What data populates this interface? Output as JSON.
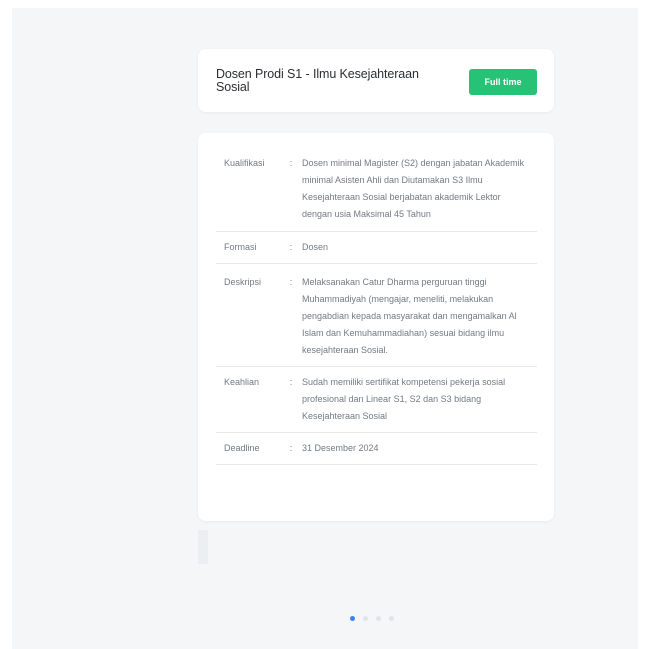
{
  "job": {
    "title": "Dosen Prodi S1 - Ilmu Kesejahteraan Sosial",
    "badge": "Full time"
  },
  "details": [
    {
      "label": "Kualifikasi",
      "value": "Dosen minimal Magister (S2) dengan jabatan Akademik minimal Asisten Ahli dan Diutamakan S3 Ilmu Kesejahteraan Sosial berjabatan akademik Lektor dengan usia Maksimal 45 Tahun"
    },
    {
      "label": "Formasi",
      "value": "Dosen"
    },
    {
      "label": "Deskripsi",
      "value": "Melaksanakan Catur Dharma perguruan tinggi Muhammadiyah (mengajar, meneliti, melakukan pengabdian kepada masyarakat dan mengamalkan Al Islam dan Kemuhammadiahan) sesuai bidang ilmu kesejahteraan Sosial."
    },
    {
      "label": "Keahlian",
      "value": "Sudah memiliki sertifikat kompetensi pekerja sosial profesional dan Linear S1, S2 dan S3 bidang Kesejahteraan Sosial"
    },
    {
      "label": "Deadline",
      "value": "31 Desember 2024"
    }
  ],
  "separator": ":",
  "pagination": {
    "total": 4,
    "active": 1
  },
  "colors": {
    "badge": "#27c275",
    "dot_active": "#3b82f6",
    "dot_inactive": "#e0e3e7",
    "background": "#f4f6f8"
  }
}
